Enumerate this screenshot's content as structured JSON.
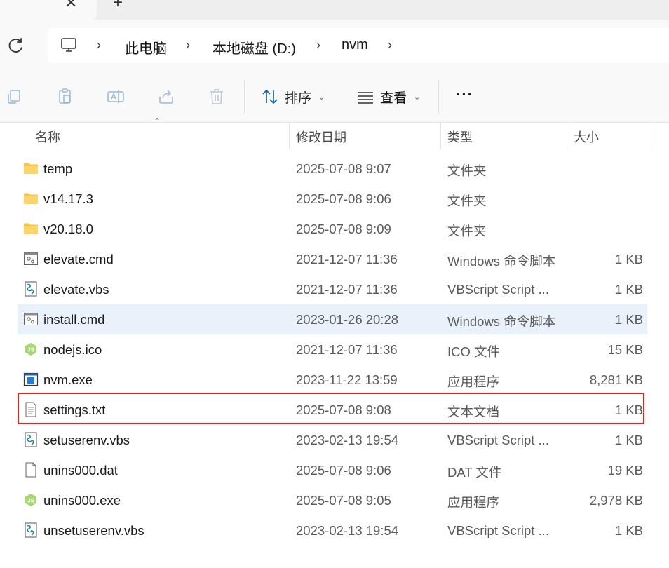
{
  "tabs": {
    "close_glyph": "✕",
    "new_tab_glyph": "+"
  },
  "breadcrumb": {
    "items": [
      "此电脑",
      "本地磁盘 (D:)",
      "nvm"
    ],
    "separator": "›"
  },
  "toolbar": {
    "sort_label": "排序",
    "view_label": "查看",
    "more_label": "···",
    "icons": [
      "copy-icon",
      "paste-icon",
      "rename-icon",
      "share-icon",
      "delete-icon"
    ]
  },
  "columns": {
    "name": "名称",
    "date": "修改日期",
    "type": "类型",
    "size": "大小"
  },
  "files": [
    {
      "name": "temp",
      "date": "2025-07-08 9:07",
      "type": "文件夹",
      "size": "",
      "icon": "folder-icon"
    },
    {
      "name": "v14.17.3",
      "date": "2025-07-08 9:06",
      "type": "文件夹",
      "size": "",
      "icon": "folder-icon"
    },
    {
      "name": "v20.18.0",
      "date": "2025-07-08 9:09",
      "type": "文件夹",
      "size": "",
      "icon": "folder-icon"
    },
    {
      "name": "elevate.cmd",
      "date": "2021-12-07 11:36",
      "type": "Windows 命令脚本",
      "size": "1 KB",
      "icon": "cmd-script-icon"
    },
    {
      "name": "elevate.vbs",
      "date": "2021-12-07 11:36",
      "type": "VBScript Script ...",
      "size": "1 KB",
      "icon": "vbs-script-icon"
    },
    {
      "name": "install.cmd",
      "date": "2023-01-26 20:28",
      "type": "Windows 命令脚本",
      "size": "1 KB",
      "icon": "cmd-script-icon"
    },
    {
      "name": "nodejs.ico",
      "date": "2021-12-07 11:36",
      "type": "ICO 文件",
      "size": "15 KB",
      "icon": "nodejs-icon"
    },
    {
      "name": "nvm.exe",
      "date": "2023-11-22 13:59",
      "type": "应用程序",
      "size": "8,281 KB",
      "icon": "exe-icon"
    },
    {
      "name": "settings.txt",
      "date": "2025-07-08 9:08",
      "type": "文本文档",
      "size": "1 KB",
      "icon": "text-file-icon"
    },
    {
      "name": "setuserenv.vbs",
      "date": "2023-02-13 19:54",
      "type": "VBScript Script ...",
      "size": "1 KB",
      "icon": "vbs-script-icon"
    },
    {
      "name": "unins000.dat",
      "date": "2025-07-08 9:06",
      "type": "DAT 文件",
      "size": "19 KB",
      "icon": "blank-file-icon"
    },
    {
      "name": "unins000.exe",
      "date": "2025-07-08 9:05",
      "type": "应用程序",
      "size": "2,978 KB",
      "icon": "nodejs-icon"
    },
    {
      "name": "unsetuserenv.vbs",
      "date": "2023-02-13 19:54",
      "type": "VBScript Script ...",
      "size": "1 KB",
      "icon": "vbs-script-icon"
    }
  ],
  "hovered_file": "install.cmd",
  "highlighted_file": "settings.txt",
  "colors": {
    "highlight_border": "#e0251f",
    "hover_bg": "#e9f2fb",
    "folder": "#f6c54a"
  }
}
